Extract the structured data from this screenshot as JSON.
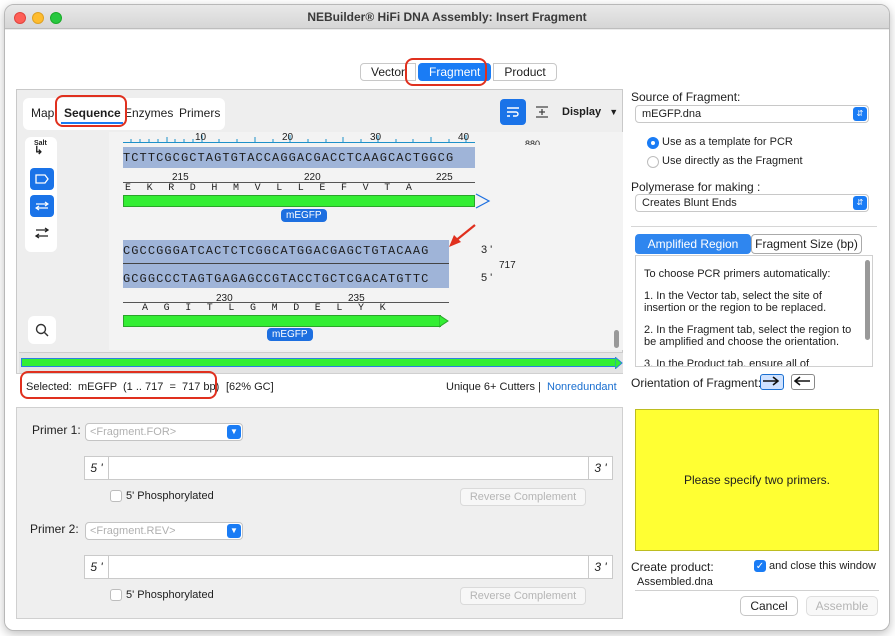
{
  "window": {
    "title": "NEBuilder® HiFi DNA Assembly: Insert Fragment"
  },
  "main_tabs": [
    {
      "label": "Vector"
    },
    {
      "label": "Fragment"
    },
    {
      "label": "Product"
    }
  ],
  "sequence_view": {
    "nav_tabs": [
      {
        "label": "Map"
      },
      {
        "label": "Sequence"
      },
      {
        "label": "Enzymes"
      },
      {
        "label": "Primers"
      }
    ],
    "display_label": "Display",
    "ruler_ticks": [
      "10",
      "20",
      "30",
      "40"
    ],
    "ruler_cut_label": "880",
    "tool_salt_label": "Salt",
    "row1": {
      "sequence": "TCTTCGCGCTAGTGTACCAGGACGACCTCAAGCACTGGCG",
      "positions": [
        "215",
        "220",
        "225"
      ],
      "amino_acids": "EKRDHMVLLEFVTA",
      "feature_label": "mEGFP"
    },
    "row2": {
      "top_strand": "CGCCGGGATCACTCTCGGCATGGACGAGCTGTACAAG",
      "bottom_strand": "GCGGCCCTAGTGAGAGCCGTACCTGCTCGACATGTTC",
      "end_top": "3 '",
      "end_bottom": "5 '",
      "end_position": "717",
      "positions": [
        "230",
        "235"
      ],
      "amino_acids": "AGITLGMDELYK",
      "feature_label": "mEGFP"
    }
  },
  "status": {
    "selected": "Selected:  mEGFP  (1 .. 717  =  717 bp)",
    "gc": "[62% GC]",
    "cutters": "Unique 6+ Cutters",
    "separator": "|",
    "nonredundant": "Nonredundant"
  },
  "primers": {
    "primer1": {
      "label": "Primer 1:",
      "popup_placeholder": "<Fragment.FOR>",
      "end5": "5 '",
      "end3": "3 '",
      "phosphorylated_label": "5' Phosphorylated",
      "reverse_label": "Reverse Complement"
    },
    "primer2": {
      "label": "Primer 2:",
      "popup_placeholder": "<Fragment.REV>",
      "end5": "5 '",
      "end3": "3 '",
      "phosphorylated_label": "5' Phosphorylated",
      "reverse_label": "Reverse Complement"
    }
  },
  "right_panel": {
    "source_label": "Source of Fragment:",
    "source_value": "mEGFP.dna",
    "radio_template": "Use as a template for PCR",
    "radio_direct": "Use directly as the Fragment",
    "polymerase_label": "Polymerase for making :",
    "polymerase_value": "Creates Blunt Ends",
    "subtabs": [
      {
        "label": "Amplified Region"
      },
      {
        "label": "Fragment Size (bp)"
      }
    ],
    "info_lines": [
      "To choose PCR primers automatically:",
      "1. In the Vector tab, select the site of insertion or the region to be replaced.",
      "2. In the Fragment tab, select the region to be amplified and choose the orientation.",
      "3. In the Product tab, ensure all of"
    ],
    "orientation_label": "Orientation of Fragment:",
    "yellow_message": "Please specify two primers.",
    "create_label": "Create product:",
    "close_window_label": "and close this window",
    "product_name": "Assembled.dna",
    "cancel_label": "Cancel",
    "assemble_label": "Assemble"
  },
  "colors": {
    "accent": "#1a7cf5",
    "feature_green": "#33ee33",
    "highlight": "#e0301e",
    "message_bg": "#ffff33"
  }
}
